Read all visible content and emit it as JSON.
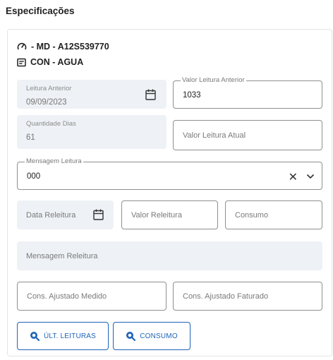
{
  "section": {
    "title": "Especificações"
  },
  "meter": {
    "label": "- MD - A12S539770",
    "icon": "gauge-icon",
    "type_label": "CON - AGUA",
    "type_icon": "card-icon"
  },
  "form": {
    "leitura_anterior": {
      "label": "Leitura Anterior",
      "value": "09/09/2023"
    },
    "valor_leitura_anterior": {
      "label": "Valor Leitura Anterior",
      "value": "1033"
    },
    "quantidade_dias": {
      "label": "Quantidade Dias",
      "value": "61"
    },
    "valor_leitura_atual": {
      "placeholder": "Valor Leitura Atual"
    },
    "mensagem_leitura": {
      "label": "Mensagem Leitura",
      "value": "000"
    },
    "data_releitura": {
      "placeholder": "Data Releitura"
    },
    "valor_releitura": {
      "placeholder": "Valor Releitura"
    },
    "consumo": {
      "placeholder": "Consumo"
    },
    "mensagem_releitura": {
      "placeholder": "Mensagem Releitura"
    },
    "cons_ajustado_medido": {
      "placeholder": "Cons. Ajustado Medido"
    },
    "cons_ajustado_faturado": {
      "placeholder": "Cons. Ajustado Faturado"
    }
  },
  "buttons": {
    "ultimas_leituras": {
      "label": "ÚLT. LEITURAS",
      "icon": "search-icon"
    },
    "consumo": {
      "label": "CONSUMO",
      "icon": "search-icon"
    }
  },
  "colors": {
    "accent": "#1e63b8",
    "field_bg": "#eef1f5",
    "border": "#8f8f8f"
  }
}
